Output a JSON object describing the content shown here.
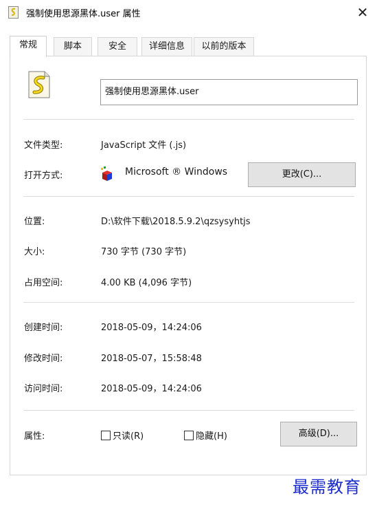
{
  "window": {
    "title": "强制使用思源黑体.user 属性",
    "close_glyph": "✕"
  },
  "tabs": [
    {
      "label": "常规",
      "active": true
    },
    {
      "label": "脚本",
      "active": false
    },
    {
      "label": "安全",
      "active": false
    },
    {
      "label": "详细信息",
      "active": false
    },
    {
      "label": "以前的版本",
      "active": false
    }
  ],
  "file": {
    "name": "强制使用思源黑体.user",
    "icon": "script-file-icon"
  },
  "details": {
    "type_label": "文件类型:",
    "type_value": "JavaScript 文件 (.js)",
    "open_with_label": "打开方式:",
    "open_with_value": "Microsoft ® Windows",
    "open_with_icon": "windows-script-host-icon",
    "change_button": "更改(C)..."
  },
  "location": {
    "location_label": "位置:",
    "location_value": "D:\\软件下载\\2018.5.9.2\\qzsysyhtjs",
    "size_label": "大小:",
    "size_value": "730 字节 (730 字节)",
    "disk_label": "占用空间:",
    "disk_value": "4.00 KB (4,096 字节)"
  },
  "times": {
    "created_label": "创建时间:",
    "created_value": "2018-05-09，14:24:06",
    "modified_label": "修改时间:",
    "modified_value": "2018-05-07，15:58:48",
    "accessed_label": "访问时间:",
    "accessed_value": "2018-05-09，14:24:06"
  },
  "attributes": {
    "label": "属性:",
    "readonly_label": "只读(R)",
    "readonly_checked": false,
    "hidden_label": "隐藏(H)",
    "hidden_checked": false,
    "advanced_button": "高级(D)..."
  },
  "watermark": "最需教育",
  "colors": {
    "watermark": "#1b2ec9",
    "button_bg": "#e3e3e3"
  }
}
